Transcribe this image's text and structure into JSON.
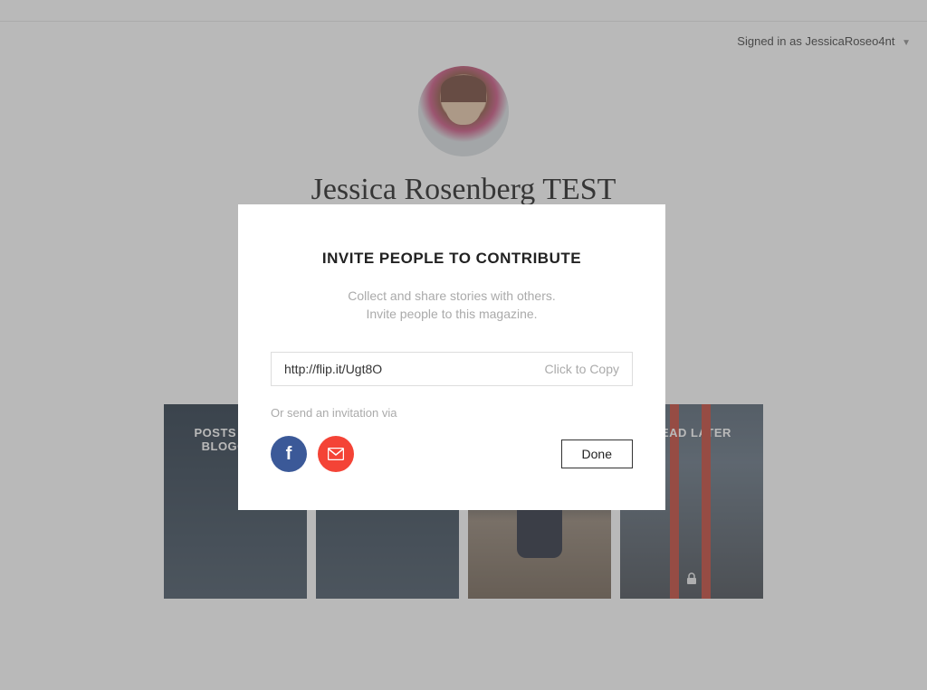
{
  "header": {
    "signed_in_prefix": "Signed in as ",
    "username": "JessicaRoseo4nt"
  },
  "profile": {
    "name": "Jessica Rosenberg TEST"
  },
  "magazines": [
    {
      "title": "POSTS FROM BLOGGING"
    },
    {
      "title": ""
    },
    {
      "title": ""
    },
    {
      "title": "READ LATER"
    }
  ],
  "modal": {
    "title": "INVITE PEOPLE TO CONTRIBUTE",
    "subtitle_line1": "Collect and share stories with others.",
    "subtitle_line2": "Invite people to this magazine.",
    "url": "http://flip.it/Ugt8O",
    "copy_label": "Click to Copy",
    "or_send": "Or send an invitation via",
    "done_label": "Done"
  },
  "icons": {
    "facebook": "f",
    "triangle": "▼",
    "lock": "🔒"
  }
}
